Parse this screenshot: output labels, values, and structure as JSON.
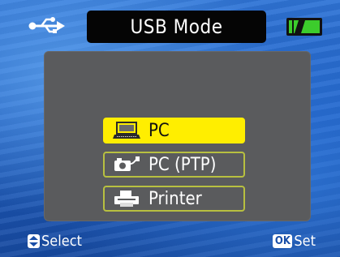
{
  "header": {
    "title": "USB Mode",
    "usb_icon": "usb-icon",
    "battery_icon": "battery-icon",
    "battery_color": "#3ccc2c"
  },
  "menu": {
    "items": [
      {
        "label": "PC",
        "icon": "laptop-icon",
        "selected": true
      },
      {
        "label": "PC (PTP)",
        "icon": "camera-link-icon",
        "selected": false
      },
      {
        "label": "Printer",
        "icon": "printer-icon",
        "selected": false
      }
    ],
    "highlight_color": "#ffee00",
    "outline_color": "#b8c040"
  },
  "footer": {
    "select_label": "Select",
    "select_icon": "select-button-icon",
    "ok_badge": "OK",
    "set_label": "Set"
  }
}
